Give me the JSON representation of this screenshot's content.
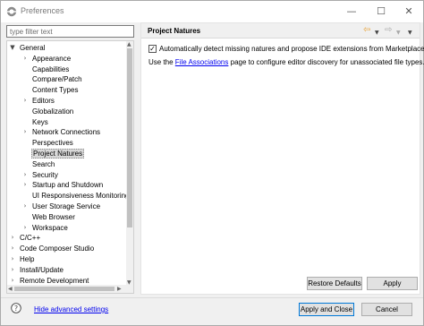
{
  "window": {
    "title": "Preferences",
    "minimize": "—",
    "maximize": "☐",
    "close": "✕"
  },
  "filter": {
    "placeholder": "type filter text",
    "value": ""
  },
  "tree": {
    "items": [
      {
        "label": "General",
        "level": 0,
        "arrow": "▼"
      },
      {
        "label": "Appearance",
        "level": 1,
        "arrow": "›"
      },
      {
        "label": "Capabilities",
        "level": 1,
        "arrow": ""
      },
      {
        "label": "Compare/Patch",
        "level": 1,
        "arrow": ""
      },
      {
        "label": "Content Types",
        "level": 1,
        "arrow": ""
      },
      {
        "label": "Editors",
        "level": 1,
        "arrow": "›"
      },
      {
        "label": "Globalization",
        "level": 1,
        "arrow": ""
      },
      {
        "label": "Keys",
        "level": 1,
        "arrow": ""
      },
      {
        "label": "Network Connections",
        "level": 1,
        "arrow": "›"
      },
      {
        "label": "Perspectives",
        "level": 1,
        "arrow": ""
      },
      {
        "label": "Project Natures",
        "level": 1,
        "arrow": "",
        "selected": true
      },
      {
        "label": "Search",
        "level": 1,
        "arrow": ""
      },
      {
        "label": "Security",
        "level": 1,
        "arrow": "›"
      },
      {
        "label": "Startup and Shutdown",
        "level": 1,
        "arrow": "›"
      },
      {
        "label": "UI Responsiveness Monitoring",
        "level": 1,
        "arrow": ""
      },
      {
        "label": "User Storage Service",
        "level": 1,
        "arrow": "›"
      },
      {
        "label": "Web Browser",
        "level": 1,
        "arrow": ""
      },
      {
        "label": "Workspace",
        "level": 1,
        "arrow": "›"
      },
      {
        "label": "C/C++",
        "level": 0,
        "arrow": "›"
      },
      {
        "label": "Code Composer Studio",
        "level": 0,
        "arrow": "›"
      },
      {
        "label": "Help",
        "level": 0,
        "arrow": "›"
      },
      {
        "label": "Install/Update",
        "level": 0,
        "arrow": "›"
      },
      {
        "label": "Remote Development",
        "level": 0,
        "arrow": "›"
      }
    ]
  },
  "page": {
    "title": "Project Natures",
    "checkbox_label": "Automatically detect missing natures and propose IDE extensions from Marketplace",
    "checkbox_checked": true,
    "info_prefix": "Use the ",
    "info_link": "File Associations",
    "info_suffix": " page to configure editor discovery for unassociated file types.",
    "restore_defaults": "Restore Defaults",
    "apply": "Apply"
  },
  "footer": {
    "hide_advanced": "Hide advanced settings",
    "apply_and_close": "Apply and Close",
    "cancel": "Cancel"
  },
  "icons": {
    "app": "eclipse-icon",
    "help": "help-icon",
    "back": "back-arrow-icon",
    "forward": "forward-arrow-icon"
  },
  "colors": {
    "link": "#0000ee",
    "selection": "#d9d9d9",
    "back_arrow": "#e8a33c",
    "default_button_border": "#0078d7"
  }
}
